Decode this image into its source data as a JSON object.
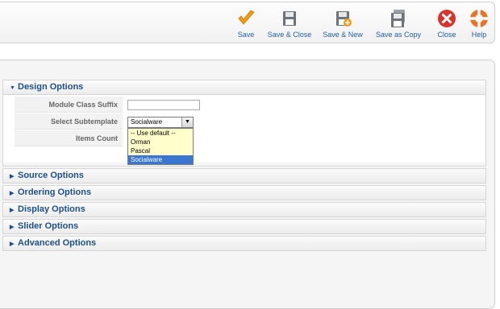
{
  "toolbar": {
    "buttons": [
      {
        "label": "Save",
        "icon": "check-icon"
      },
      {
        "label": "Save & Close",
        "icon": "floppy-icon"
      },
      {
        "label": "Save & New",
        "icon": "floppy-plus-icon"
      },
      {
        "label": "Save as Copy",
        "icon": "floppy-copy-icon"
      },
      {
        "label": "Close",
        "icon": "close-icon"
      },
      {
        "label": "Help",
        "icon": "help-icon"
      }
    ]
  },
  "sections": {
    "design": {
      "title": "Design Options",
      "expanded": true,
      "fields": {
        "module_class_suffix": {
          "label": "Module Class Suffix",
          "value": ""
        },
        "select_subtemplate": {
          "label": "Select Subtemplate",
          "value": "Socialware",
          "options": [
            "-- Use default --",
            "Orman",
            "Pascal",
            "Socialware"
          ],
          "selected_index": 3
        },
        "items_count": {
          "label": "Items Count"
        }
      }
    },
    "source": {
      "title": "Source Options"
    },
    "ordering": {
      "title": "Ordering Options"
    },
    "display": {
      "title": "Display Options"
    },
    "slider": {
      "title": "Slider Options"
    },
    "advanced": {
      "title": "Advanced Options"
    }
  },
  "colors": {
    "accent_blue": "#1d4f8a",
    "save_orange": "#f39c12",
    "close_red": "#d9342b",
    "help_orange": "#e8742a",
    "dropdown_bg": "#ffffcc",
    "selected_option": "#3b76d1"
  }
}
